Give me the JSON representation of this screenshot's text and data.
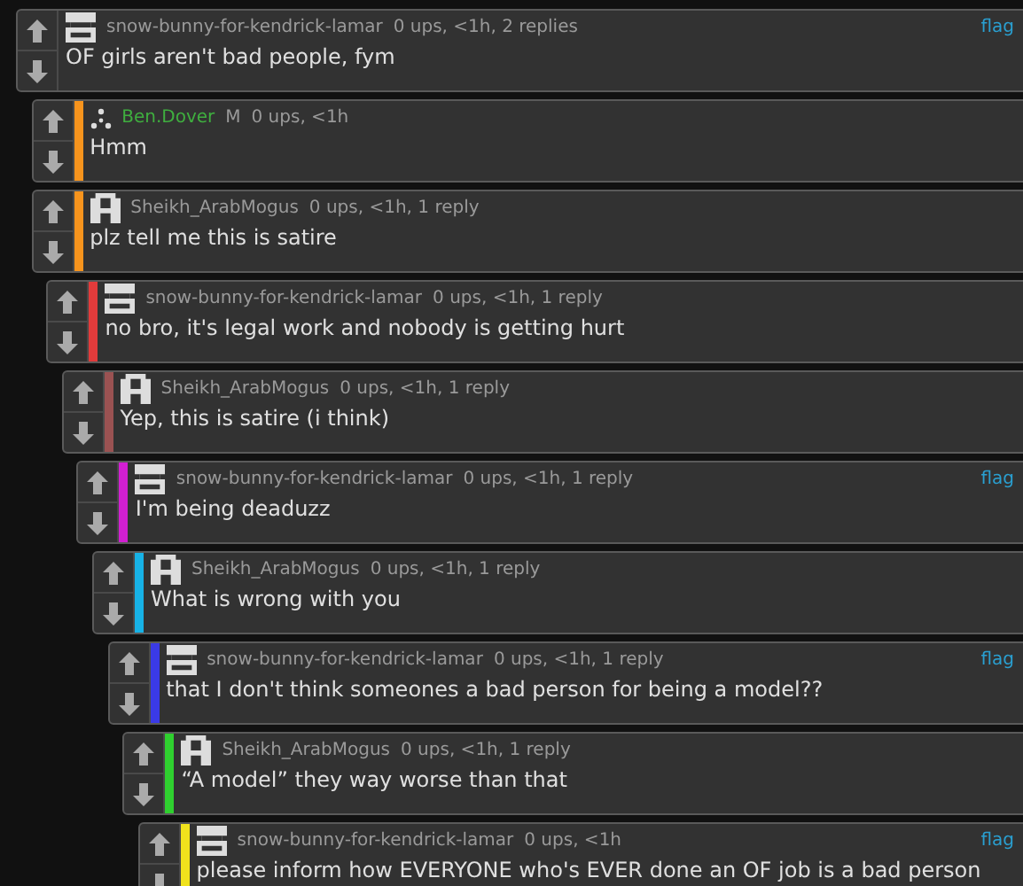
{
  "comments": [
    {
      "author": {
        "name": "snow-bunny-for-kendrick-lamar",
        "kind": "stripes"
      },
      "meta": "0 ups, <1h, 2 replies",
      "flag": "flag",
      "text": "OF girls aren't bad people, fym",
      "children": [
        {
          "author": {
            "name": "Ben.Dover",
            "kind": "dots",
            "color": "#3fae3f"
          },
          "badge": "M",
          "meta": "0 ups, <1h",
          "color": "#f7941d",
          "text": "Hmm"
        },
        {
          "author": {
            "name": "Sheikh_ArabMogus",
            "kind": "arch"
          },
          "meta": "0 ups, <1h, 1 reply",
          "color": "#f7941d",
          "text": "plz tell me this is satire",
          "children": [
            {
              "author": {
                "name": "snow-bunny-for-kendrick-lamar",
                "kind": "stripes"
              },
              "meta": "0 ups, <1h, 1 reply",
              "color": "#e23b3b",
              "text": "no bro, it's legal work and nobody is getting hurt",
              "children": [
                {
                  "author": {
                    "name": "Sheikh_ArabMogus",
                    "kind": "arch"
                  },
                  "meta": "0 ups, <1h, 1 reply",
                  "color": "#9a5252",
                  "text": "Yep, this is satire (i think)",
                  "children": [
                    {
                      "author": {
                        "name": "snow-bunny-for-kendrick-lamar",
                        "kind": "stripes"
                      },
                      "meta": "0 ups, <1h, 1 reply",
                      "flag": "flag",
                      "color": "#d21fd2",
                      "text": "I'm being deaduzz",
                      "children": [
                        {
                          "author": {
                            "name": "Sheikh_ArabMogus",
                            "kind": "arch"
                          },
                          "meta": "0 ups, <1h, 1 reply",
                          "color": "#17b2e6",
                          "text": "What is wrong with you",
                          "children": [
                            {
                              "author": {
                                "name": "snow-bunny-for-kendrick-lamar",
                                "kind": "stripes"
                              },
                              "meta": "0 ups, <1h, 1 reply",
                              "flag": "flag",
                              "color": "#3a3ae6",
                              "text": "that I don't think someones a bad person for being a model??",
                              "children": [
                                {
                                  "author": {
                                    "name": "Sheikh_ArabMogus",
                                    "kind": "arch"
                                  },
                                  "meta": "0 ups, <1h, 1 reply",
                                  "color": "#2fd02f",
                                  "text": "“A model” they way worse than that",
                                  "children": [
                                    {
                                      "author": {
                                        "name": "snow-bunny-for-kendrick-lamar",
                                        "kind": "stripes"
                                      },
                                      "meta": "0 ups, <1h",
                                      "flag": "flag",
                                      "color": "#f0e21c",
                                      "text": "please inform how EVERYONE who's EVER done an OF job is a bad person"
                                    }
                                  ]
                                }
                              ]
                            }
                          ]
                        }
                      ]
                    }
                  ]
                }
              ]
            }
          ]
        }
      ]
    }
  ]
}
